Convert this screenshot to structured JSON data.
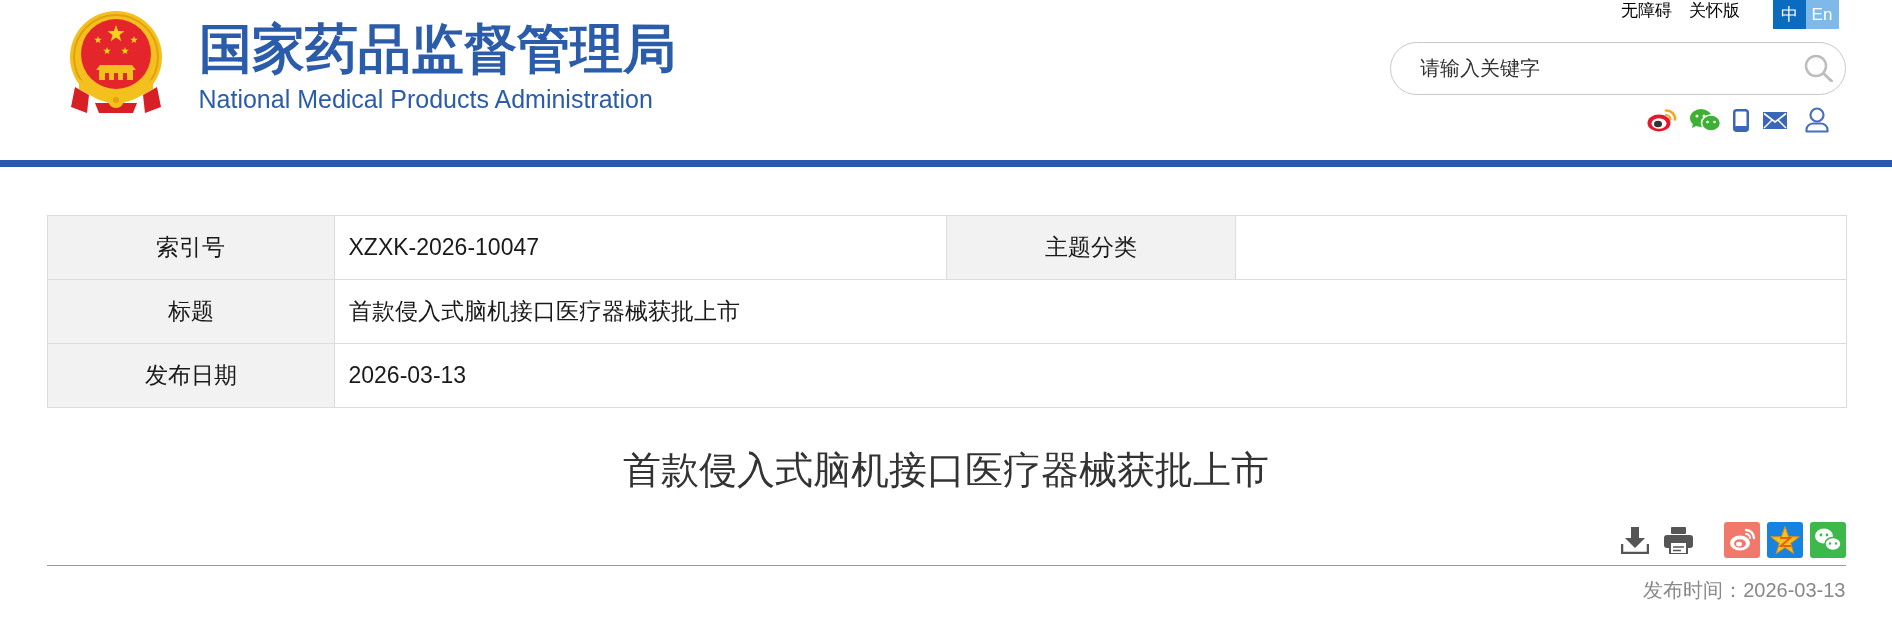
{
  "header": {
    "title": "国家药品监督管理局",
    "subtitle": "National Medical Products Administration",
    "top_links": [
      "无障碍",
      "关怀版"
    ],
    "languages": [
      {
        "label": "中",
        "selected": true
      },
      {
        "label": "En",
        "selected": false
      }
    ],
    "search": {
      "placeholder": "请输入关键字"
    }
  },
  "info_table": {
    "rows": [
      {
        "cells": [
          {
            "label": "索引号",
            "value": "XZXK-2026-10047"
          },
          {
            "label": "主题分类"
          }
        ]
      },
      {
        "cells": [
          {
            "label": "标题",
            "value": "首款侵入式脑机接口医疗器械获批上市"
          }
        ]
      },
      {
        "cells": [
          {
            "label": "发布日期",
            "value": "2026-03-13"
          }
        ]
      }
    ]
  },
  "article": {
    "title": "首款侵入式脑机接口医疗器械获批上市",
    "publish_time": "发布时间：2026-03-13"
  }
}
